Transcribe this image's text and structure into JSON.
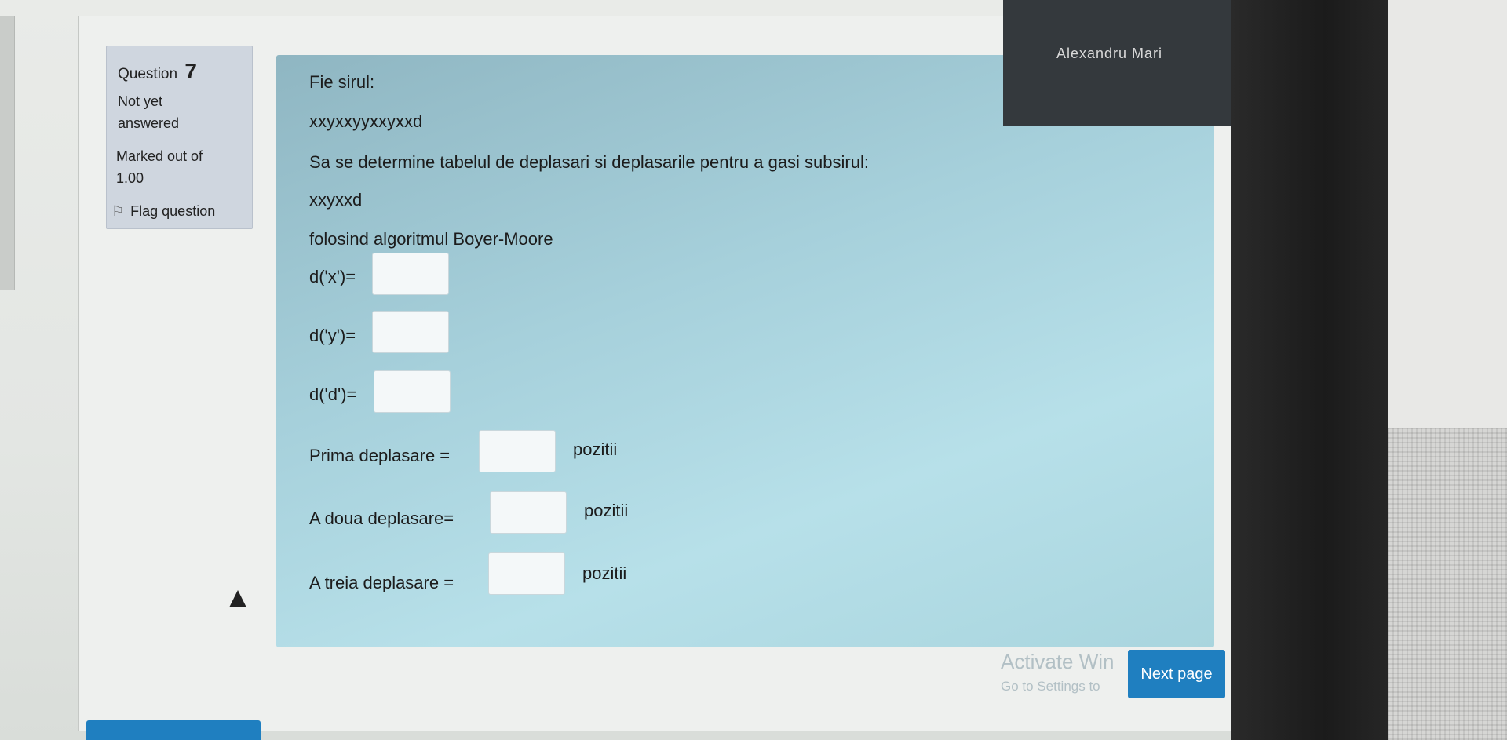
{
  "question_info": {
    "question_label": "Question",
    "question_number": "7",
    "status_line1": "Not yet",
    "status_line2": "answered",
    "marks_label": "Marked out of",
    "marks_value": "1.00",
    "flag_label": "Flag question"
  },
  "question": {
    "intro": "Fie sirul:",
    "string": "xxyxxyyxxyxxd",
    "task": "Sa se determine tabelul de deplasari si deplasarile pentru a gasi subsirul:",
    "pattern": "xxyxxd",
    "method": "folosind algoritmul Boyer-Moore",
    "fields": [
      {
        "label": "d('x')=",
        "value": "",
        "suffix": ""
      },
      {
        "label": "d('y')=",
        "value": "",
        "suffix": ""
      },
      {
        "label": "d('d')=",
        "value": "",
        "suffix": ""
      },
      {
        "label": "Prima deplasare =",
        "value": "",
        "suffix": "pozitii"
      },
      {
        "label": "A doua deplasare=",
        "value": "",
        "suffix": "pozitii"
      },
      {
        "label": "A treia deplasare =",
        "value": "",
        "suffix": "pozitii"
      }
    ]
  },
  "user_menu": {
    "name": "Alexandru Mari"
  },
  "watermark": {
    "line1": "Activate Win",
    "line2": "Go to Settings to"
  },
  "navigation": {
    "next_label": "Next page"
  },
  "colors": {
    "accent": "#1f7fc0",
    "content_bg": "#a6d0db",
    "info_bg": "#cfd6df",
    "user_menu_bg": "#34393d"
  }
}
